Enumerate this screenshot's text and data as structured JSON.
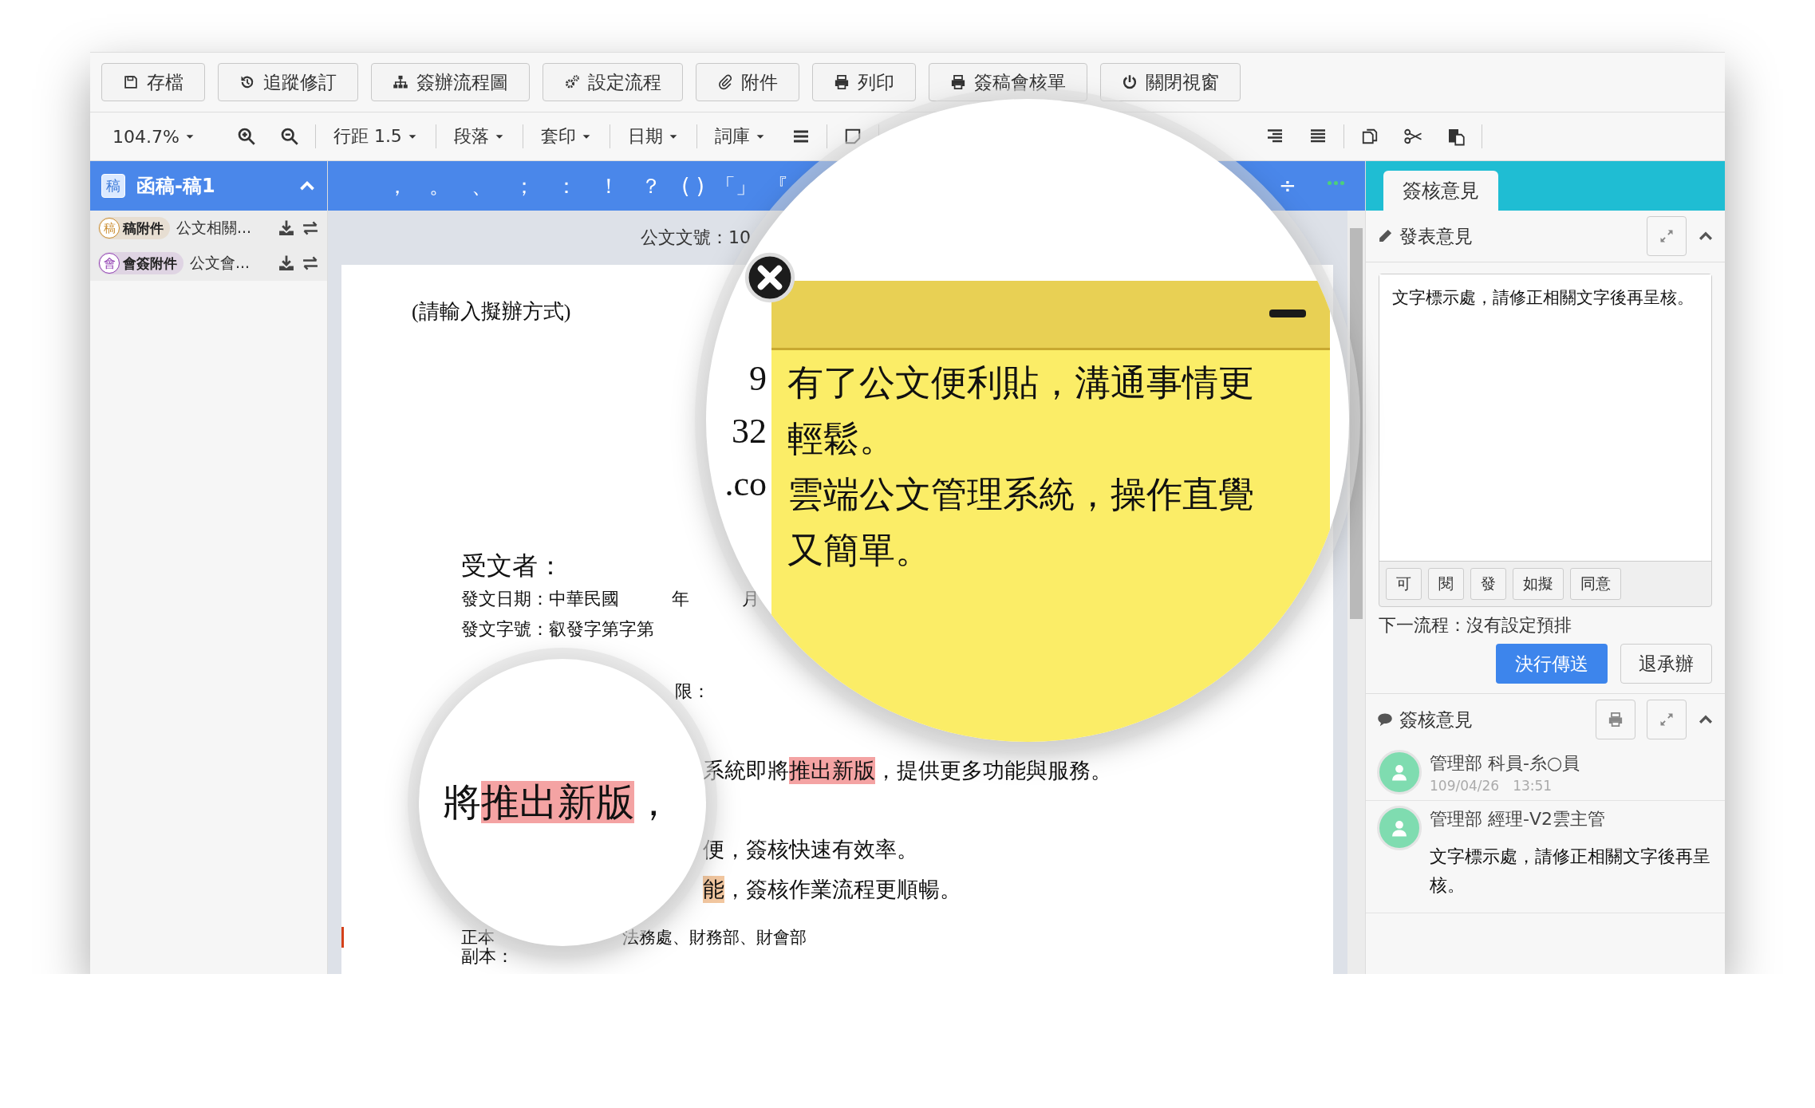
{
  "toolbar": {
    "buttons": [
      "存檔",
      "追蹤修訂",
      "簽辦流程圖",
      "設定流程",
      "附件",
      "列印",
      "簽稿會核單",
      "關閉視窗"
    ]
  },
  "format_bar": {
    "zoom": "104.7%",
    "dropdowns": [
      "行距 1.5",
      "段落",
      "套印",
      "日期",
      "詞庫"
    ]
  },
  "left_panel": {
    "icon_char": "稿",
    "title": "函稿-稿1",
    "attachments": [
      {
        "badge_char": "稿",
        "badge_label": "稿附件",
        "name": "公文相關...",
        "color": "#c98a2b"
      },
      {
        "badge_char": "會",
        "badge_label": "會簽附件",
        "name": "公文會...",
        "color": "#8e3bb0"
      }
    ]
  },
  "punctuation": [
    "，",
    "。",
    "、",
    "；",
    "：",
    "！",
    "？",
    "( )",
    "「」",
    "『"
  ],
  "punctuation_right": "÷",
  "document": {
    "number": "公文文號：10",
    "lines": [
      {
        "kind": "title",
        "segments": [
          {
            "text": "(請輸入擬辦方式)"
          }
        ]
      },
      {
        "kind": "heading",
        "segments": [
          {
            "text": "受文者："
          }
        ]
      },
      {
        "kind": "field",
        "segments": [
          {
            "text": "發文日期：中華民國　　　年　　　月"
          }
        ]
      },
      {
        "kind": "field",
        "segments": [
          {
            "text": "發文字號：叡發字第字第"
          }
        ]
      },
      {
        "kind": "tail",
        "segments": [
          {
            "text": "限："
          }
        ]
      },
      {
        "kind": "body",
        "segments": [
          {
            "text": "系統即將"
          },
          {
            "text": "推出新版",
            "color": "#f4a3a3"
          },
          {
            "text": "，提供更多功能與服務。"
          }
        ]
      },
      {
        "kind": "body",
        "segments": [
          {
            "text": "便，簽核快速有效率。"
          }
        ]
      },
      {
        "kind": "body",
        "segments": [
          {
            "text": "能",
            "color": "#f2c7a0"
          },
          {
            "text": "，簽核作業流程更順暢。"
          }
        ]
      },
      {
        "kind": "copy",
        "segments": [
          {
            "text": "正本"
          },
          {
            "text": "法務處、財務部、財會部"
          }
        ]
      },
      {
        "kind": "field",
        "segments": [
          {
            "text": "副本："
          }
        ]
      }
    ]
  },
  "big_lens": {
    "fragments": [
      "9",
      "32",
      ".co"
    ],
    "sticky_note": {
      "text": [
        "有了公文便利貼，溝通事情更輕鬆。",
        "雲端公文管理系統，操作直覺又簡單。"
      ]
    }
  },
  "small_lens": {
    "segments": [
      {
        "text": "將"
      },
      {
        "text": "推出新版",
        "color": "#f4a3a3"
      },
      {
        "text": "，"
      }
    ]
  },
  "right_panel": {
    "tab": {
      "label": "簽核意見",
      "selected": true
    },
    "compose": {
      "title": "發表意見",
      "value": "文字標示處，請修正相關文字後再呈核。",
      "quick_phrases": [
        "可",
        "閱",
        "發",
        "如擬",
        "同意"
      ],
      "next_step": "下一流程：沒有設定預排",
      "submit": "決行傳送",
      "return": "退承辦"
    },
    "history": {
      "title": "簽核意見",
      "entries": [
        {
          "author": "管理部 科員-糸○員",
          "time": "109/04/26　13:51"
        },
        {
          "author": "管理部 經理-V2雲主管",
          "comment": "文字標示處，請修正相關文字後再呈核。"
        }
      ]
    }
  }
}
